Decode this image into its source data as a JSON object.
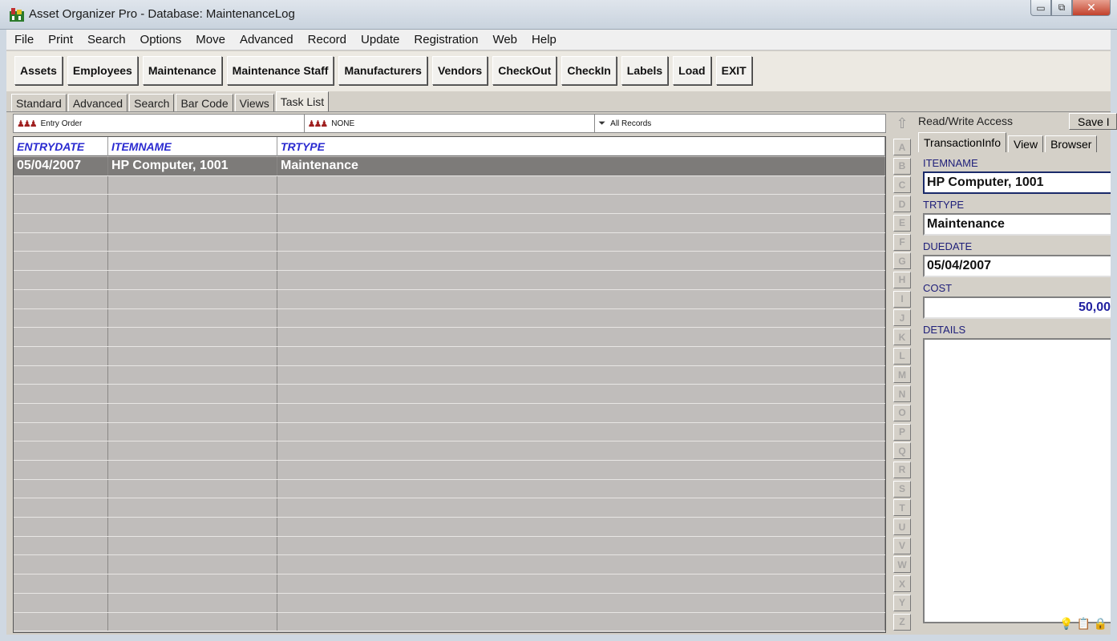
{
  "window": {
    "title": "Asset Organizer Pro - Database: MaintenanceLog",
    "min_glyph": "▭",
    "max_glyph": "⧉",
    "close_glyph": "✕"
  },
  "menu": [
    "File",
    "Print",
    "Search",
    "Options",
    "Move",
    "Advanced",
    "Record",
    "Update",
    "Registration",
    "Web",
    "Help"
  ],
  "toolbar": [
    "Assets",
    "Employees",
    "Maintenance",
    "Maintenance Staff",
    "Manufacturers",
    "Vendors",
    "CheckOut",
    "CheckIn",
    "Labels",
    "Load",
    "EXIT"
  ],
  "view_tabs": [
    "Standard",
    "Advanced",
    "Search",
    "Bar Code",
    "Views",
    "Task List"
  ],
  "active_view_tab": "Task List",
  "filters": {
    "sort": "Entry Order",
    "group": "NONE",
    "records": "All Records"
  },
  "grid": {
    "columns": [
      "ENTRYDATE",
      "ITEMNAME",
      "TRTYPE"
    ],
    "rows": [
      [
        "05/04/2007",
        "HP Computer, 1001",
        "Maintenance"
      ]
    ],
    "empty_rows": 24
  },
  "alphabet": [
    "A",
    "B",
    "C",
    "D",
    "E",
    "F",
    "G",
    "H",
    "I",
    "J",
    "K",
    "L",
    "M",
    "N",
    "O",
    "P",
    "Q",
    "R",
    "S",
    "T",
    "U",
    "V",
    "W",
    "X",
    "Y",
    "Z"
  ],
  "alpha_up": "⇧",
  "right_panel": {
    "access": "Read/Write Access",
    "save_label": "Save I",
    "tabs": [
      "TransactionInfo",
      "View",
      "Browser"
    ],
    "fields": {
      "itemname_label": "ITEMNAME",
      "itemname_value": "HP Computer, 1001",
      "trtype_label": "TRTYPE",
      "trtype_value": "Maintenance",
      "duedate_label": "DUEDATE",
      "duedate_value": "05/04/2007",
      "cost_label": "COST",
      "cost_value": "50,00",
      "details_label": "DETAILS",
      "details_value": ""
    }
  },
  "icons": {
    "app": "app-icon",
    "filter_sort": "people-sort-icon",
    "filter_group": "people-group-icon",
    "filter_records": "funnel-icon",
    "status": [
      "bulb-icon",
      "copy-icon",
      "lock-icon"
    ]
  },
  "colors": {
    "column_header": "#2a2ad0",
    "selected_row": "#7d7b79",
    "field_label": "#20207a",
    "cost_value": "#2121a0"
  }
}
